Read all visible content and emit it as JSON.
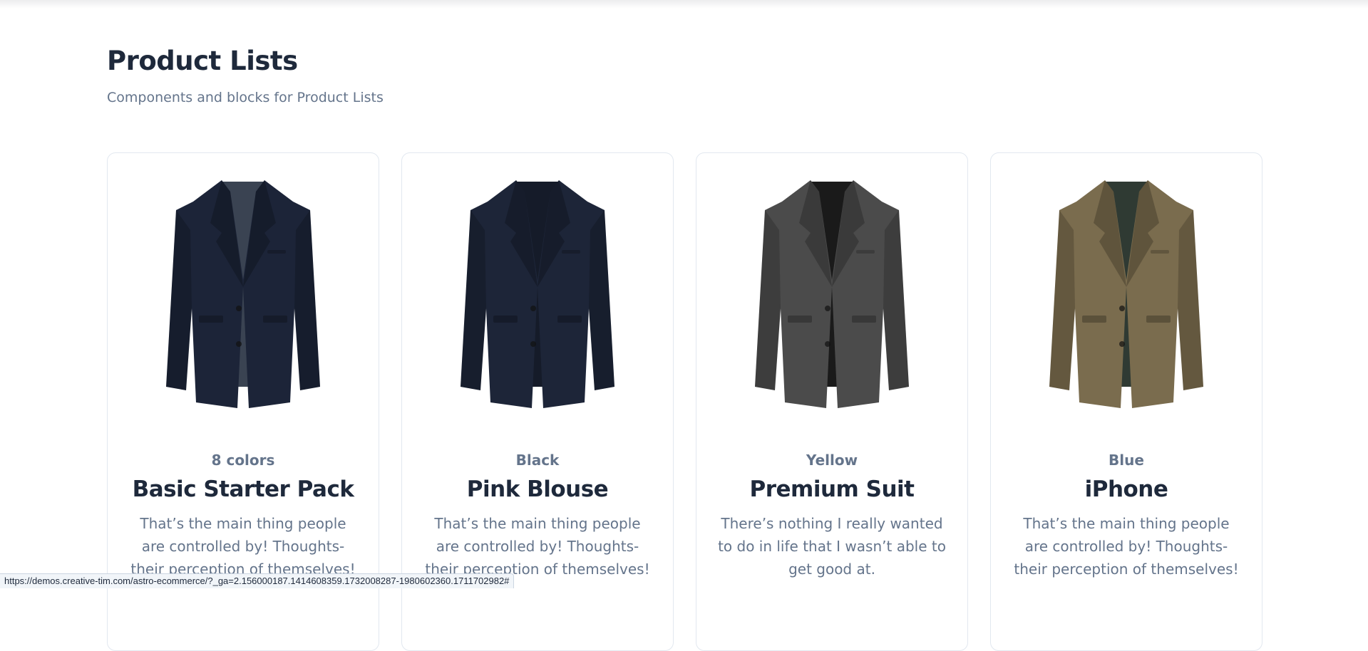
{
  "header": {
    "title": "Product Lists",
    "subtitle": "Components and blocks for Product Lists"
  },
  "products": [
    {
      "meta": "8 colors",
      "title": "Basic Starter Pack",
      "description": "That’s the main thing people are controlled by! Thoughts- their perception of themselves!",
      "image": "navy-suit-jacket",
      "color": "#1c2438",
      "lining": "#3a4352"
    },
    {
      "meta": "Black",
      "title": "Pink Blouse",
      "description": "That’s the main thing people are controlled by! Thoughts- their perception of themselves!",
      "image": "navy-blazer-gold-buttons",
      "color": "#1d2538",
      "lining": "#151b29"
    },
    {
      "meta": "Yellow",
      "title": "Premium Suit",
      "description": "There’s nothing I really wanted to do in life that I wasn’t able to get good at.",
      "image": "grey-suit-jacket",
      "color": "#4b4b4b",
      "lining": "#1a1a1a"
    },
    {
      "meta": "Blue",
      "title": "iPhone",
      "description": "That’s the main thing people are controlled by! Thoughts- their perception of themselves!",
      "image": "olive-suit-jacket",
      "color": "#7a6c4e",
      "lining": "#2f3a33"
    }
  ],
  "status_bar": {
    "url": "https://demos.creative-tim.com/astro-ecommerce/?_ga=2.156000187.1414608359.1732008287-1980602360.1711702982#"
  }
}
